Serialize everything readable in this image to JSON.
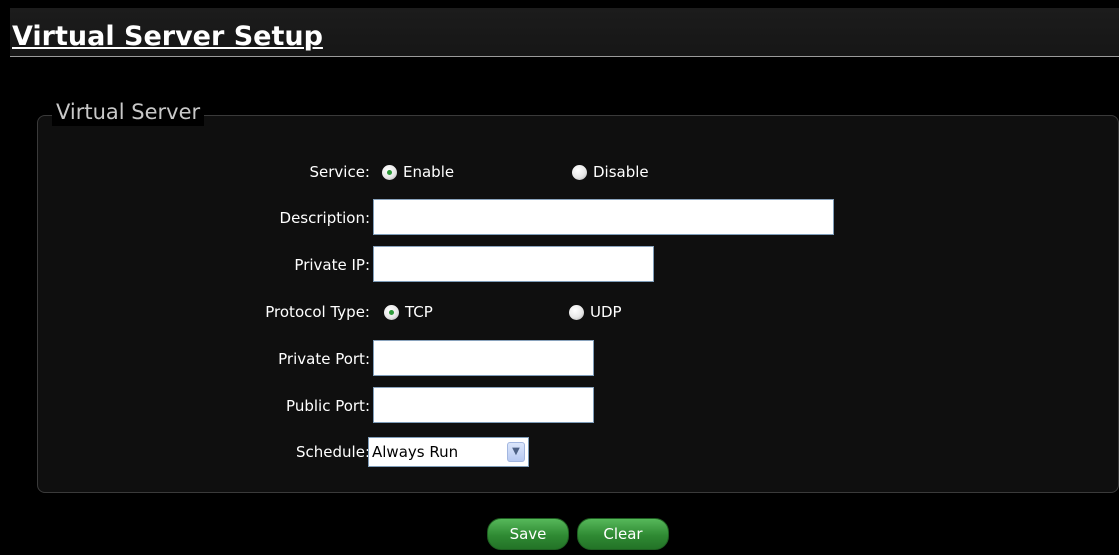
{
  "page": {
    "title": "Virtual Server Setup"
  },
  "fieldset": {
    "legend": "Virtual Server"
  },
  "form": {
    "service": {
      "label": "Service:",
      "options": [
        "Enable",
        "Disable"
      ],
      "selected": "Enable"
    },
    "description": {
      "label": "Description:",
      "value": ""
    },
    "private_ip": {
      "label": "Private IP:",
      "value": ""
    },
    "protocol_type": {
      "label": "Protocol Type:",
      "options": [
        "TCP",
        "UDP"
      ],
      "selected": "TCP"
    },
    "private_port": {
      "label": "Private Port:",
      "value": ""
    },
    "public_port": {
      "label": "Public Port:",
      "value": ""
    },
    "schedule": {
      "label": "Schedule:",
      "value": "Always Run"
    }
  },
  "buttons": {
    "save": "Save",
    "clear": "Clear"
  },
  "colors": {
    "background": "#000000",
    "button_green": "#2f8a33",
    "radio_selected": "#2e9a3a",
    "input_border": "#7f9db9"
  }
}
